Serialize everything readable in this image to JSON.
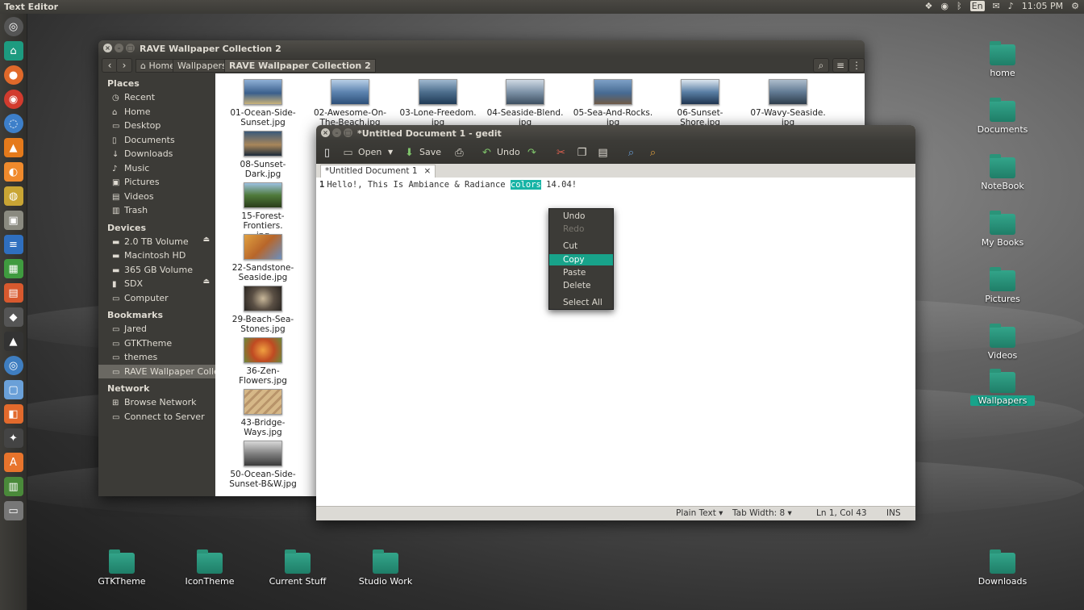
{
  "top_panel": {
    "app_title": "Text Editor",
    "keyboard_layout": "En",
    "clock": "11:05 PM"
  },
  "desktop_icons": [
    {
      "label": "home"
    },
    {
      "label": "Documents"
    },
    {
      "label": "NoteBook"
    },
    {
      "label": "My Books"
    },
    {
      "label": "Pictures"
    },
    {
      "label": "Videos"
    },
    {
      "label": "Wallpapers"
    },
    {
      "label": "GTKTheme"
    },
    {
      "label": "IconTheme"
    },
    {
      "label": "Current Stuff"
    },
    {
      "label": "Studio Work"
    },
    {
      "label": "Downloads"
    }
  ],
  "file_manager": {
    "title": "RAVE Wallpaper Collection 2",
    "breadcrumbs": [
      "Home",
      "Wallpapers",
      "RAVE Wallpaper Collection 2"
    ],
    "sidebar": {
      "places_header": "Places",
      "places": [
        "Recent",
        "Home",
        "Desktop",
        "Documents",
        "Downloads",
        "Music",
        "Pictures",
        "Videos",
        "Trash"
      ],
      "devices_header": "Devices",
      "devices": [
        "2.0 TB Volume",
        "Macintosh HD",
        "365 GB Volume",
        "SDX",
        "Computer"
      ],
      "bookmarks_header": "Bookmarks",
      "bookmarks": [
        "Jared",
        "GTKTheme",
        "themes",
        "RAVE Wallpaper Colle..."
      ],
      "network_header": "Network",
      "network": [
        "Browse Network",
        "Connect to Server"
      ]
    },
    "files": [
      {
        "name": "01-Ocean-Side-\nSunset.jpg"
      },
      {
        "name": "02-Awesome-On-\nThe-Beach.jpg"
      },
      {
        "name": "03-Lone-Freedom.\njpg"
      },
      {
        "name": "04-Seaside-Blend.\njpg"
      },
      {
        "name": "05-Sea-And-Rocks.\njpg"
      },
      {
        "name": "06-Sunset-Shore.jpg"
      },
      {
        "name": "07-Wavy-Seaside.\njpg"
      },
      {
        "name": "08-Sunset-Dark.jpg"
      },
      {
        "name": "15-Forest-Frontiers.\njpg"
      },
      {
        "name": "22-Sandstone-\nSeaside.jpg"
      },
      {
        "name": "29-Beach-Sea-\nStones.jpg"
      },
      {
        "name": "36-Zen-Flowers.jpg"
      },
      {
        "name": "43-Bridge-Ways.jpg"
      },
      {
        "name": "50-Ocean-Side-\nSunset-B&W.jpg"
      }
    ]
  },
  "gedit": {
    "title": "*Untitled Document 1 - gedit",
    "toolbar": {
      "open": "Open",
      "save": "Save",
      "undo": "Undo"
    },
    "tab_label": "*Untitled Document 1",
    "line_number": "1",
    "text_before": "Hello!, This Is Ambiance & Radiance ",
    "text_selected": "colors",
    "text_after": " 14.04!",
    "status": {
      "language": "Plain Text",
      "tab_width": "Tab Width: 8",
      "position": "Ln 1, Col 43",
      "mode": "INS"
    }
  },
  "context_menu": {
    "items": [
      {
        "label": "Undo",
        "enabled": true
      },
      {
        "label": "Redo",
        "enabled": false
      },
      {
        "label": "Cut",
        "enabled": true
      },
      {
        "label": "Copy",
        "enabled": true,
        "highlighted": true
      },
      {
        "label": "Paste",
        "enabled": true
      },
      {
        "label": "Delete",
        "enabled": true
      },
      {
        "label": "Select All",
        "enabled": true
      }
    ]
  },
  "colors": {
    "accent": "#18a38a",
    "panel": "#3c3b37",
    "text_light": "#dfdbd2"
  }
}
